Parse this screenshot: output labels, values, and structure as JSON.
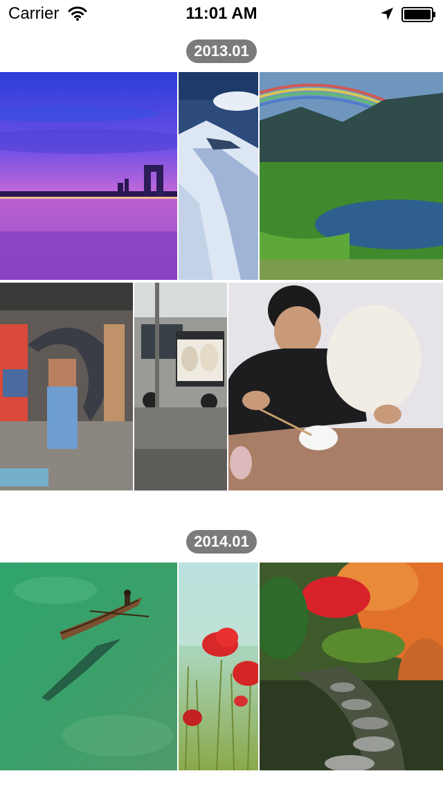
{
  "status_bar": {
    "carrier": "Carrier",
    "time": "11:01 AM",
    "icons": [
      "wifi-icon",
      "location-arrow-icon",
      "battery-icon"
    ]
  },
  "sections": [
    {
      "date_label": "2013.01",
      "photos": [
        {
          "subject": "city-skyline-night-purple"
        },
        {
          "subject": "snowy-mountain-peak"
        },
        {
          "subject": "rainbow-over-lake-meadow"
        },
        {
          "subject": "man-carrying-giant-fish"
        },
        {
          "subject": "goats-in-van"
        },
        {
          "subject": "man-with-giant-bun"
        }
      ]
    },
    {
      "date_label": "2014.01",
      "photos": [
        {
          "subject": "boat-on-clear-water"
        },
        {
          "subject": "red-poppies"
        },
        {
          "subject": "autumn-garden-stepping-stones"
        }
      ]
    }
  ]
}
